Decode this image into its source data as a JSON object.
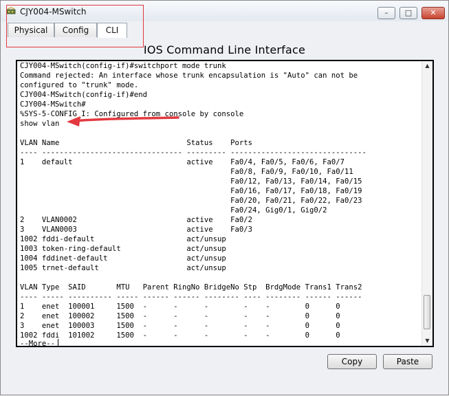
{
  "window": {
    "title": "CJY004-MSwitch",
    "minimize_glyph": "–",
    "maximize_glyph": "□",
    "close_glyph": "✕"
  },
  "tabs": [
    {
      "label": "Physical"
    },
    {
      "label": "Config"
    },
    {
      "label": "CLI",
      "active": true
    }
  ],
  "heading": "IOS Command Line Interface",
  "console": {
    "lines": [
      "CJY004-MSwitch(config-if)#switchport mode trunk",
      "Command rejected: An interface whose trunk encapsulation is \"Auto\" can not be",
      "configured to \"trunk\" mode.",
      "CJY004-MSwitch(config-if)#end",
      "CJY004-MSwitch#",
      "%SYS-5-CONFIG_I: Configured from console by console",
      "show vlan",
      "",
      "VLAN Name                             Status    Ports",
      "---- -------------------------------- --------- -------------------------------",
      "1    default                          active    Fa0/4, Fa0/5, Fa0/6, Fa0/7",
      "                                                Fa0/8, Fa0/9, Fa0/10, Fa0/11",
      "                                                Fa0/12, Fa0/13, Fa0/14, Fa0/15",
      "                                                Fa0/16, Fa0/17, Fa0/18, Fa0/19",
      "                                                Fa0/20, Fa0/21, Fa0/22, Fa0/23",
      "                                                Fa0/24, Gig0/1, Gig0/2",
      "2    VLAN0002                         active    Fa0/2",
      "3    VLAN0003                         active    Fa0/3",
      "1002 fddi-default                     act/unsup",
      "1003 token-ring-default               act/unsup",
      "1004 fddinet-default                  act/unsup",
      "1005 trnet-default                    act/unsup",
      "",
      "VLAN Type  SAID       MTU   Parent RingNo BridgeNo Stp  BrdgMode Trans1 Trans2",
      "---- ----- ---------- ----- ------ ------ -------- ---- -------- ------ ------",
      "1    enet  100001     1500  -      -      -        -    -        0      0",
      "2    enet  100002     1500  -      -      -        -    -        0      0",
      "3    enet  100003     1500  -      -      -        -    -        0      0",
      "1002 fddi  101002     1500  -      -      -        -    -        0      0"
    ],
    "more_prompt": " --More--"
  },
  "buttons": {
    "copy": "Copy",
    "paste": "Paste"
  },
  "scrollbar": {
    "up_glyph": "▲",
    "down_glyph": "▼"
  },
  "colors": {
    "annotation_red": "#e2393f",
    "terminal_bg": "#ffffff",
    "terminal_text": "#000000"
  }
}
